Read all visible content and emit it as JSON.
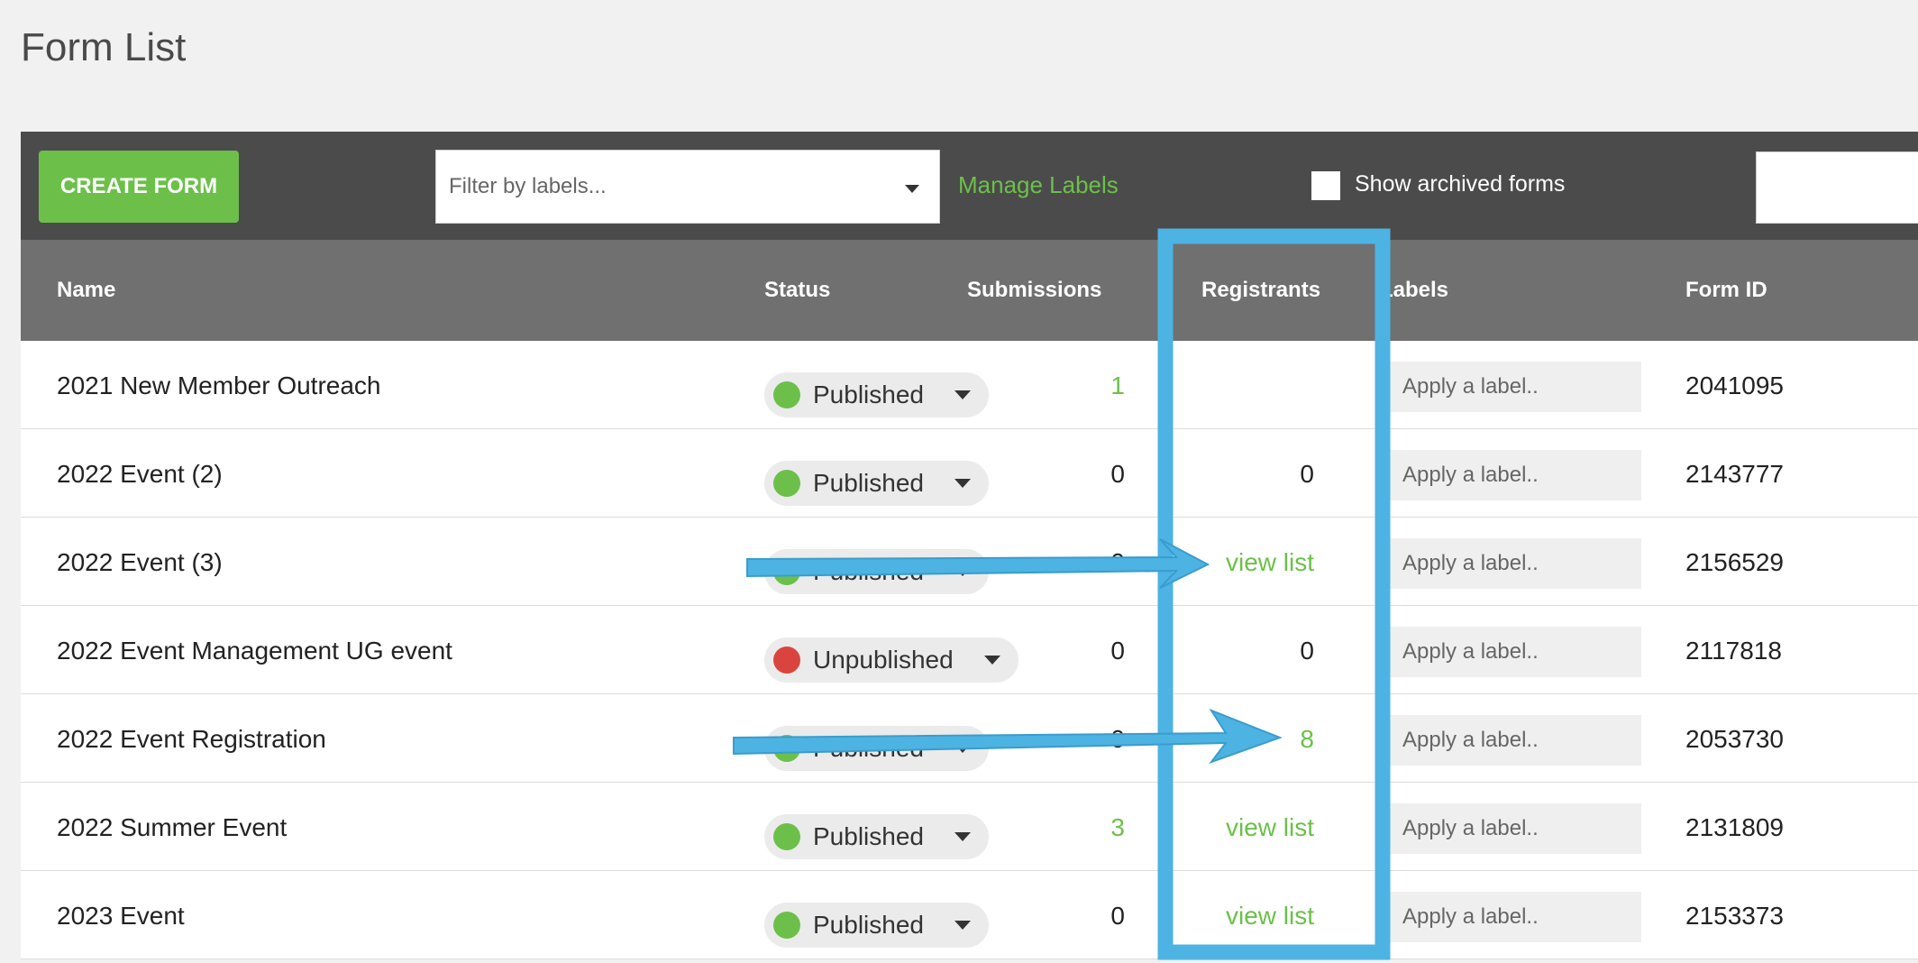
{
  "page": {
    "title": "Form List"
  },
  "toolbar": {
    "create_label": "CREATE FORM",
    "filter_placeholder": "Filter by labels...",
    "manage_labels": "Manage Labels",
    "show_archived": "Show archived forms"
  },
  "columns": {
    "name": "Name",
    "status": "Status",
    "submissions": "Submissions",
    "registrants": "Registrants",
    "labels": "Labels",
    "form_id": "Form ID"
  },
  "rows": [
    {
      "name": "2021 New Member Outreach",
      "status": "Published",
      "submissions": "1",
      "registrants": "",
      "label": "Apply a label..",
      "form_id": "2041095"
    },
    {
      "name": "2022 Event (2)",
      "status": "Published",
      "submissions": "0",
      "registrants": "0",
      "label": "Apply a label..",
      "form_id": "2143777"
    },
    {
      "name": "2022 Event (3)",
      "status": "Published",
      "submissions": "0",
      "registrants": "view list",
      "label": "Apply a label..",
      "form_id": "2156529"
    },
    {
      "name": "2022 Event Management UG event",
      "status": "Unpublished",
      "submissions": "0",
      "registrants": "0",
      "label": "Apply a label..",
      "form_id": "2117818"
    },
    {
      "name": "2022 Event Registration",
      "status": "Published",
      "submissions": "0",
      "registrants": "8",
      "label": "Apply a label..",
      "form_id": "2053730"
    },
    {
      "name": "2022 Summer Event",
      "status": "Published",
      "submissions": "3",
      "registrants": "view list",
      "label": "Apply a label..",
      "form_id": "2131809"
    },
    {
      "name": "2023 Event",
      "status": "Published",
      "submissions": "0",
      "registrants": "view list",
      "label": "Apply a label..",
      "form_id": "2153373"
    }
  ],
  "colors": {
    "accent_green": "#6cc04a",
    "unpublished_red": "#d9453e",
    "annotation_blue": "#4db3e3"
  }
}
